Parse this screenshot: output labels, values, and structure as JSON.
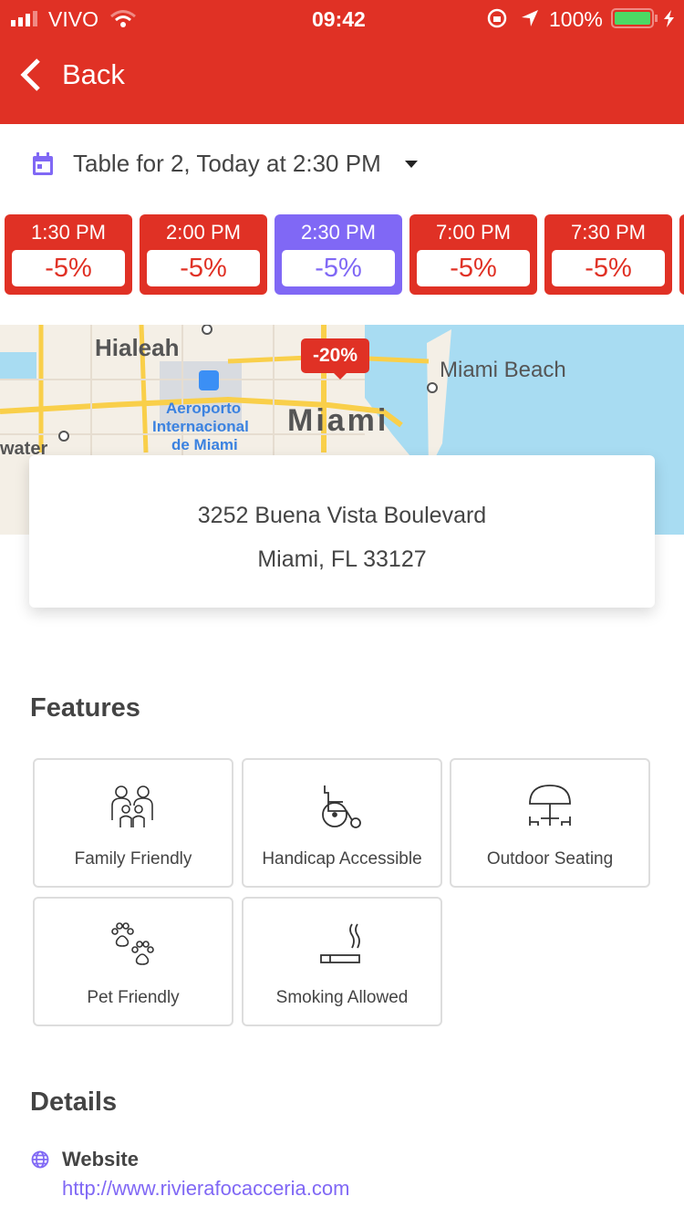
{
  "status_bar": {
    "carrier": "VIVO",
    "time": "09:42",
    "battery": "100%"
  },
  "nav": {
    "back_label": "Back"
  },
  "reservation": {
    "summary": "Table for 2, Today at 2:30 PM"
  },
  "time_slots": [
    {
      "time": "1:30 PM",
      "discount": "-5%",
      "selected": false
    },
    {
      "time": "2:00 PM",
      "discount": "-5%",
      "selected": false
    },
    {
      "time": "2:30 PM",
      "discount": "-5%",
      "selected": true
    },
    {
      "time": "7:00 PM",
      "discount": "-5%",
      "selected": false
    },
    {
      "time": "7:30 PM",
      "discount": "-5%",
      "selected": false
    }
  ],
  "map": {
    "labels": {
      "hialeah": "Hialeah",
      "miami_beach": "Miami Beach",
      "miami": "Miami",
      "airport_1": "Aeroporto",
      "airport_2": "Internacional",
      "airport_3": "de Miami",
      "water": "water"
    },
    "pin_discount": "-20%"
  },
  "address": {
    "line1": "3252 Buena Vista Boulevard",
    "line2": "Miami, FL 33127"
  },
  "features": {
    "title": "Features",
    "items": [
      {
        "label": "Family Friendly",
        "icon": "family-icon"
      },
      {
        "label": "Handicap Accessible",
        "icon": "wheelchair-icon"
      },
      {
        "label": "Outdoor Seating",
        "icon": "umbrella-table-icon"
      },
      {
        "label": "Pet Friendly",
        "icon": "paw-icon"
      },
      {
        "label": "Smoking Allowed",
        "icon": "cigarette-icon"
      }
    ]
  },
  "details": {
    "title": "Details",
    "website_label": "Website",
    "website_url": "http://www.rivierafocacceria.com"
  },
  "colors": {
    "brand_red": "#e03125",
    "accent_purple": "#8068f5"
  }
}
